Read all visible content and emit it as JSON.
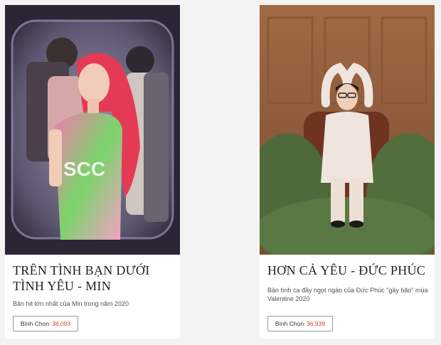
{
  "cards": [
    {
      "image_alt": "Min performing with pink hair",
      "title": "TRÊN TÌNH BẠN DƯỚI TÌNH YÊU - MIN",
      "description": "Bản hit lớn nhất của Min trong năm 2020",
      "vote_label": "Bình Chọn",
      "vote_count": "38,093"
    },
    {
      "image_alt": "Đức Phúc making a heart shape above his head",
      "title": "HƠN CẢ YÊU - ĐỨC PHÚC",
      "description": "Bản tình ca đầy ngọt ngào của Đức Phúc \"gây bão\" mùa Valentine 2020",
      "vote_label": "Bình Chọn",
      "vote_count": "36,939"
    }
  ],
  "colors": {
    "background": "#f3f3f3",
    "card": "#ffffff",
    "vote_count": "#e0412a"
  }
}
